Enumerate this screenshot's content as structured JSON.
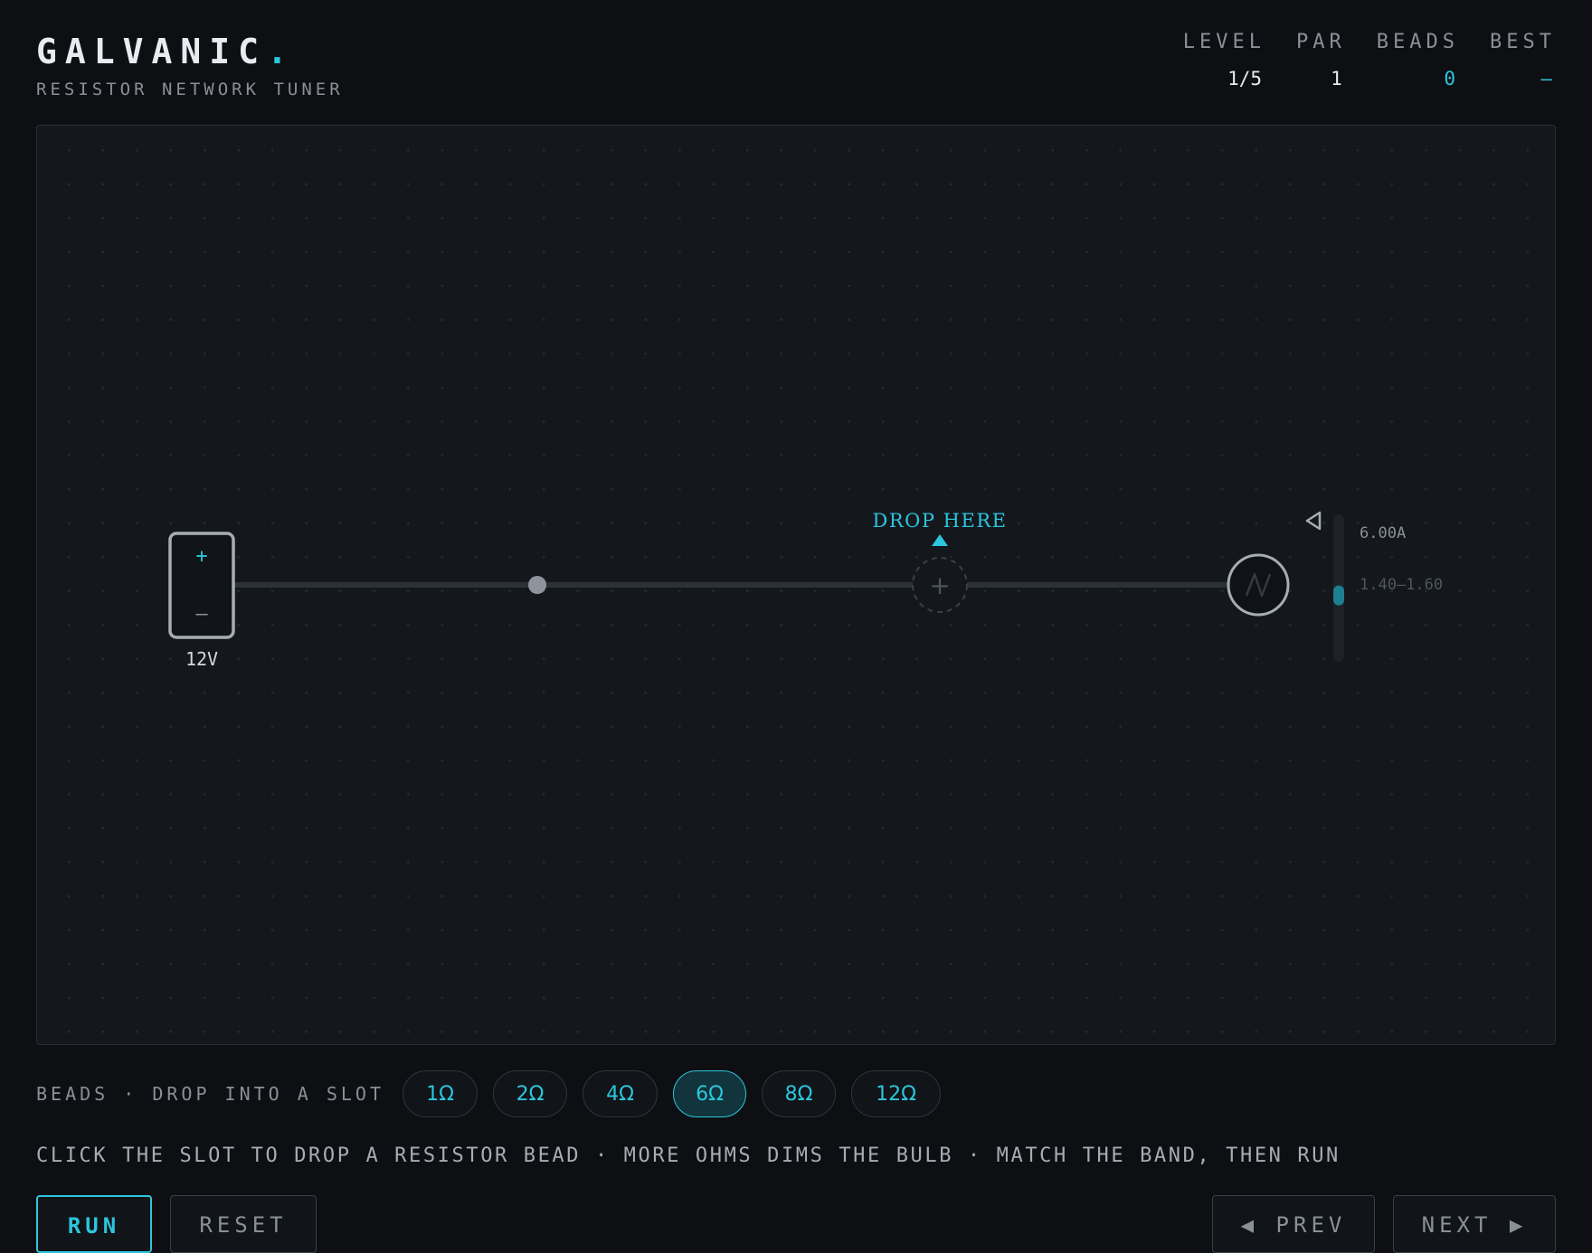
{
  "header": {
    "title": "GALVANIC",
    "title_dot": ".",
    "subtitle": "RESISTOR NETWORK TUNER"
  },
  "stats": {
    "level_label": "LEVEL",
    "level_value": "1/5",
    "par_label": "PAR",
    "par_value": "1",
    "beads_label": "BEADS",
    "beads_value": "0",
    "best_label": "BEST",
    "best_value": "–"
  },
  "circuit": {
    "battery_plus": "+",
    "battery_minus": "–",
    "battery_voltage": "12V",
    "drop_label": "DROP HERE",
    "slot_icon": "+",
    "meter_current": "6.00A",
    "meter_band": "1.40–1.60",
    "meter_level": 0.45
  },
  "beads": {
    "label": "BEADS · DROP INTO A SLOT",
    "items": [
      "1Ω",
      "2Ω",
      "4Ω",
      "6Ω",
      "8Ω",
      "12Ω"
    ],
    "selected": "6Ω"
  },
  "hint": "CLICK THE SLOT TO DROP A RESISTOR BEAD · MORE OHMS DIMS THE BULB · MATCH THE BAND, THEN RUN",
  "buttons": {
    "run": "RUN",
    "reset": "RESET",
    "prev": "◀ PREV",
    "next": "NEXT ▶"
  },
  "colors": {
    "accent": "#2cc6dd",
    "background": "#0d0f13",
    "board": "#14171c"
  }
}
